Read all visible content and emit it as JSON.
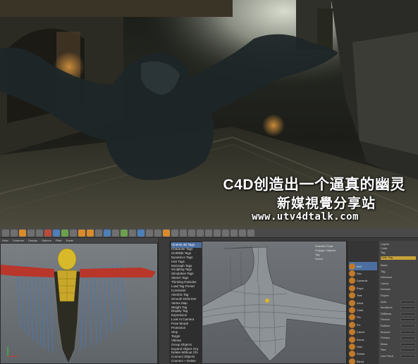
{
  "captions": {
    "line1": "C4D创造出一个逼真的幽灵",
    "line2": "新媒視覺分享站",
    "line3": "www.utv4dtalk.com"
  },
  "c4d": {
    "menu_items": [
      "Cinema 4D Tags",
      "Character Tags",
      "Clothilde Tags",
      "Dynamics Tags",
      "Hair Tags",
      "MoGraph Tags",
      "Sculpting Tags",
      "Simulation Tags",
      "Sketch Tags",
      "Thinking Particles",
      "Load Tag Preset",
      "Constraint",
      "Alembic Tag",
      "Smooth Deformer",
      "Vertex Map",
      "Weight Tag",
      "Display Tag",
      "Expression",
      "Look At Camera",
      "Pose Morph",
      "Protection",
      "Stop",
      "Target",
      "Vibrate",
      "Group Objects",
      "Expand Object Grp",
      "Delete Without Chi",
      "Connect Objects",
      "Connect + Delete"
    ],
    "selected_menu_item": 0,
    "tags": [
      "Belt",
      "Sim",
      "Dynamic",
      "Rope",
      "Tear",
      "Wind",
      "Cloth",
      "Pin",
      "Fix",
      "Cache",
      "Dress",
      "Sew",
      "Shrink",
      "Blend"
    ],
    "selected_tag": 0,
    "attr_header": [
      "Layers",
      "Cloth",
      "Tag",
      "Cloth Tag"
    ],
    "attr_rows": [
      "Basic",
      "Tag",
      "Influence",
      "Cache",
      "Dresser",
      "Expert",
      "Auto",
      "Iterations",
      "Stiffness",
      "Flexion",
      "Rubber",
      "Bounce",
      "Friction",
      "Mass",
      "Size",
      "Use Fixed"
    ],
    "viewport_stats": [
      "Selected Total",
      "Polygon Objects",
      "Tag",
      "Scene"
    ],
    "menubar": [
      "View",
      "Cameras",
      "Display",
      "Options",
      "Filter",
      "Panel"
    ],
    "colors": {
      "accent": "#4c6fa0",
      "orange": "#d98b2b",
      "viewport": "#656a6e",
      "panel": "#3a3a3a"
    }
  }
}
